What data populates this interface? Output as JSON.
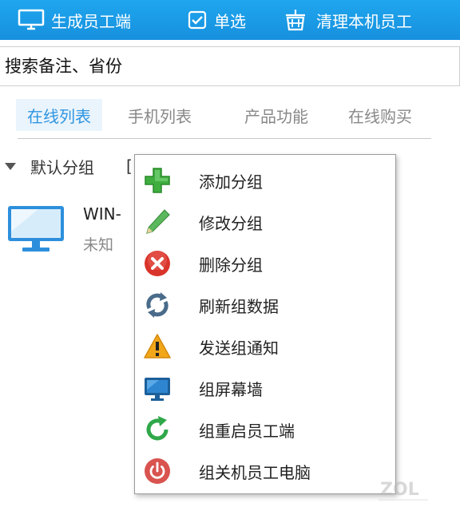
{
  "toolbar": {
    "generate_label": "生成员工端",
    "select_label": "单选",
    "clean_label": "清理本机员工"
  },
  "search": {
    "placeholder": "搜索备注、省份"
  },
  "tabs": [
    {
      "label": "在线列表",
      "active": true
    },
    {
      "label": "手机列表",
      "active": false
    },
    {
      "label": "产品功能",
      "active": false
    },
    {
      "label": "在线购买",
      "active": false
    }
  ],
  "group": {
    "label": "默认分组",
    "bracket": "["
  },
  "pc": {
    "name": "WIN-",
    "status": "未知"
  },
  "menu": {
    "items": [
      {
        "label": "添加分组",
        "icon": "plus-icon"
      },
      {
        "label": "修改分组",
        "icon": "pencil-icon"
      },
      {
        "label": "删除分组",
        "icon": "delete-icon"
      },
      {
        "label": "刷新组数据",
        "icon": "refresh-icon"
      },
      {
        "label": "发送组通知",
        "icon": "warning-icon"
      },
      {
        "label": "组屏幕墙",
        "icon": "monitor-icon"
      },
      {
        "label": "组重启员工端",
        "icon": "restart-icon"
      },
      {
        "label": "组关机员工电脑",
        "icon": "power-icon"
      }
    ]
  },
  "watermark": {
    "text": "ZOL"
  },
  "colors": {
    "toolbar": "#1a9be8",
    "tab_active": "#2f95e0",
    "plus": "#3fae3f",
    "delete": "#d9342b",
    "warning": "#f2a619",
    "power": "#d9534f"
  }
}
